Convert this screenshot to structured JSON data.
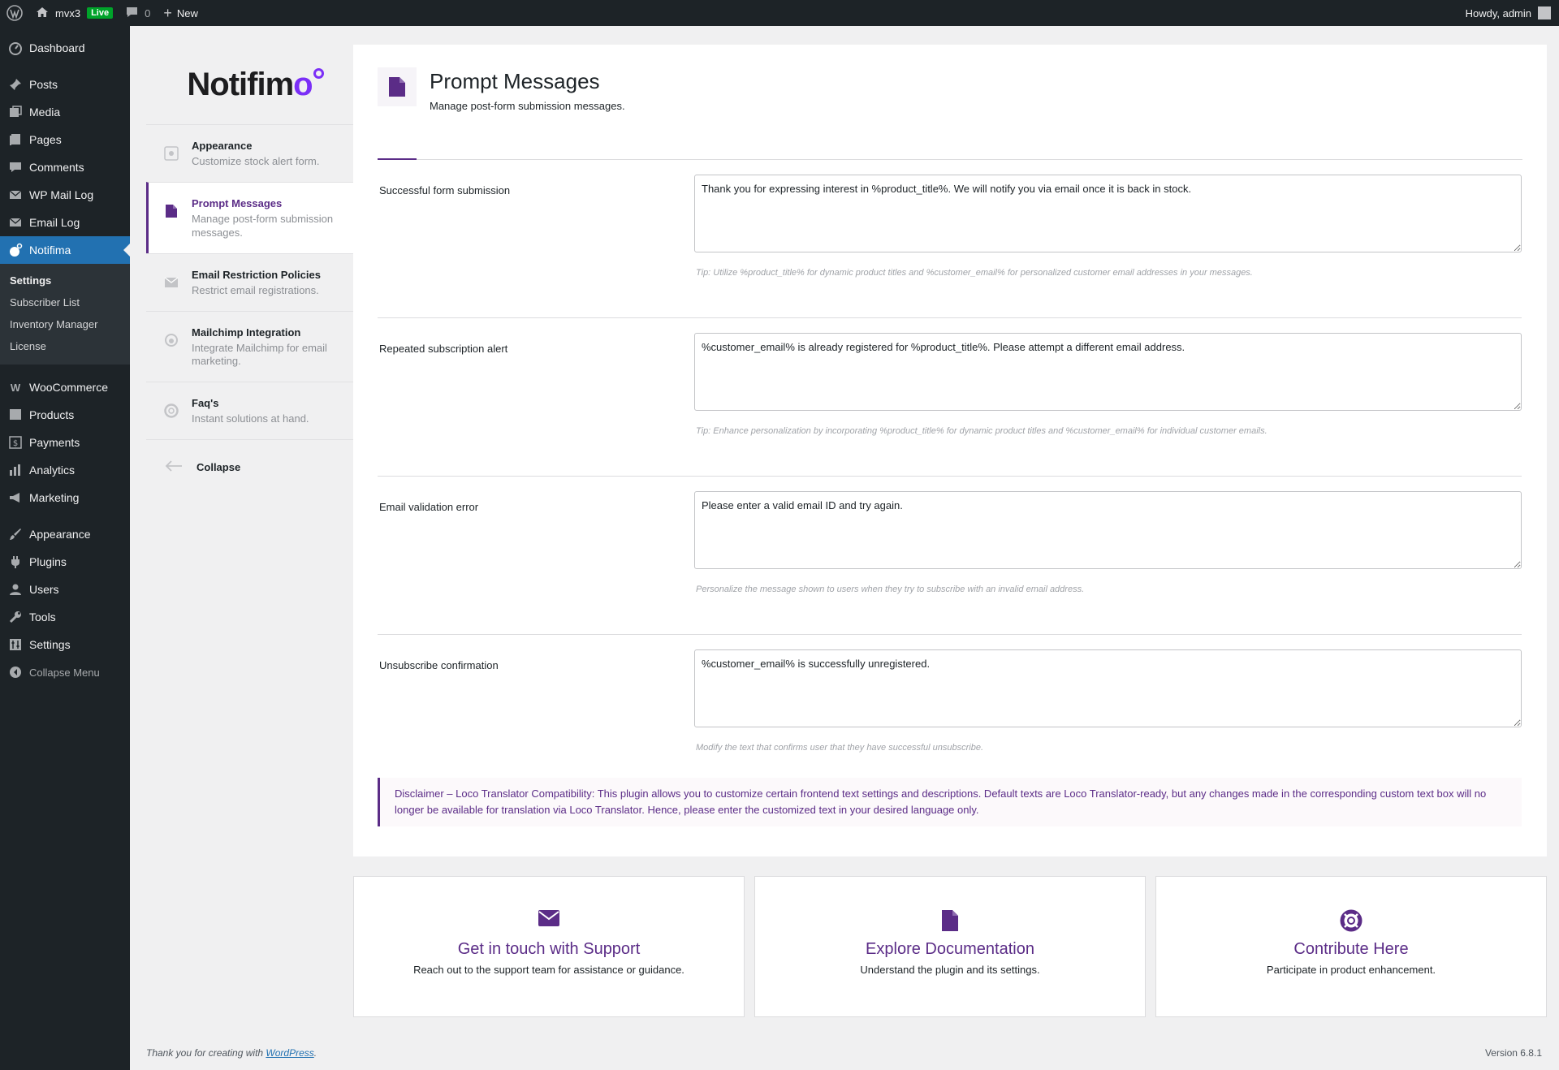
{
  "adminbar": {
    "site_name": "mvx3",
    "live_badge": "Live",
    "comments_count": "0",
    "new_label": "New",
    "greeting": "Howdy, admin"
  },
  "sidebar": {
    "items_top": [
      {
        "label": "Dashboard",
        "icon": "dashboard-icon"
      }
    ],
    "items_content": [
      {
        "label": "Posts",
        "icon": "pin-icon"
      },
      {
        "label": "Media",
        "icon": "media-icon"
      },
      {
        "label": "Pages",
        "icon": "pages-icon"
      },
      {
        "label": "Comments",
        "icon": "comment-icon"
      },
      {
        "label": "WP Mail Log",
        "icon": "mail-icon"
      },
      {
        "label": "Email Log",
        "icon": "mail-icon"
      },
      {
        "label": "Notifima",
        "icon": "notifima-icon"
      }
    ],
    "notifima_submenu": [
      "Settings",
      "Subscriber List",
      "Inventory Manager",
      "License"
    ],
    "items_woo": [
      {
        "label": "WooCommerce",
        "icon": "woo-icon"
      },
      {
        "label": "Products",
        "icon": "products-icon"
      },
      {
        "label": "Payments",
        "icon": "payments-icon"
      },
      {
        "label": "Analytics",
        "icon": "analytics-icon"
      },
      {
        "label": "Marketing",
        "icon": "marketing-icon"
      }
    ],
    "items_admin": [
      {
        "label": "Appearance",
        "icon": "brush-icon"
      },
      {
        "label": "Plugins",
        "icon": "plugin-icon"
      },
      {
        "label": "Users",
        "icon": "user-icon"
      },
      {
        "label": "Tools",
        "icon": "wrench-icon"
      },
      {
        "label": "Settings",
        "icon": "settings-icon"
      }
    ],
    "collapse_label": "Collapse Menu"
  },
  "brand": {
    "name_main": "Notifim",
    "name_end": "o"
  },
  "settings_nav": [
    {
      "title": "Appearance",
      "desc": "Customize stock alert form."
    },
    {
      "title": "Prompt Messages",
      "desc": "Manage post-form submission messages."
    },
    {
      "title": "Email Restriction Policies",
      "desc": "Restrict email registrations."
    },
    {
      "title": "Mailchimp Integration",
      "desc": "Integrate Mailchimp for email marketing."
    },
    {
      "title": "Faq's",
      "desc": "Instant solutions at hand."
    }
  ],
  "settings_nav_collapse": "Collapse",
  "page": {
    "title": "Prompt Messages",
    "description": "Manage post-form submission messages."
  },
  "fields": [
    {
      "label": "Successful form submission",
      "value": "Thank you for expressing interest in %product_title%. We will notify you via email once it is back in stock.",
      "tip": "Tip: Utilize %product_title% for dynamic product titles and %customer_email% for personalized customer email addresses in your messages."
    },
    {
      "label": "Repeated subscription alert",
      "value": "%customer_email% is already registered for %product_title%. Please attempt a different email address.",
      "tip": "Tip: Enhance personalization by incorporating %product_title% for dynamic product titles and %customer_email% for individual customer emails."
    },
    {
      "label": "Email validation error",
      "value": "Please enter a valid email ID and try again.",
      "tip": "Personalize the message shown to users when they try to subscribe with an invalid email address."
    },
    {
      "label": "Unsubscribe confirmation",
      "value": "%customer_email% is successfully unregistered.",
      "tip": "Modify the text that confirms user that they have successful unsubscribe."
    }
  ],
  "disclaimer": "Disclaimer – Loco Translator Compatibility: This plugin allows you to customize certain frontend text settings and descriptions. Default texts are Loco Translator-ready, but any changes made in the corresponding custom text box will no longer be available for translation via Loco Translator. Hence, please enter the customized text in your desired language only.",
  "cards": [
    {
      "title": "Get in touch with Support",
      "desc": "Reach out to the support team for assistance or guidance.",
      "icon": "envelope-icon"
    },
    {
      "title": "Explore Documentation",
      "desc": "Understand the plugin and its settings.",
      "icon": "document-icon"
    },
    {
      "title": "Contribute Here",
      "desc": "Participate in product enhancement.",
      "icon": "lifebuoy-icon"
    }
  ],
  "footer": {
    "thanks_prefix": "Thank you for creating with ",
    "wordpress_link": "WordPress",
    "thanks_suffix": ".",
    "version": "Version 6.8.1"
  },
  "colors": {
    "accent": "#5b2c87",
    "admin_dark": "#1d2327",
    "admin_active": "#2271b1",
    "live_green": "#00a32a"
  }
}
